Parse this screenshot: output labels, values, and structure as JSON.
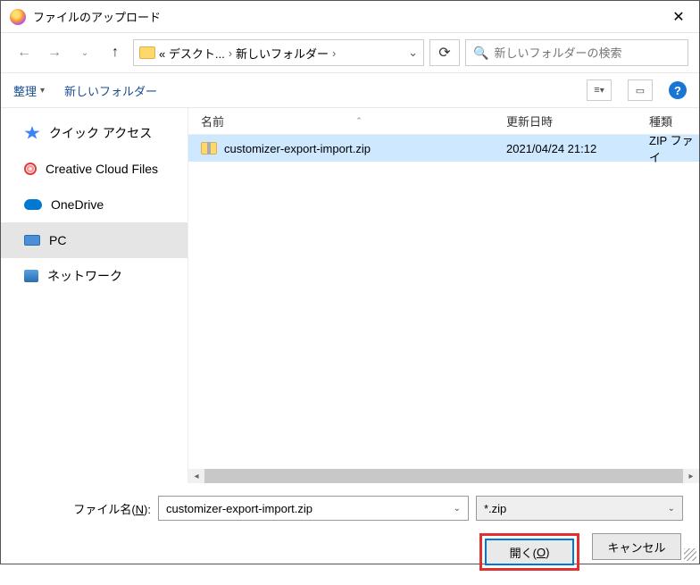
{
  "window": {
    "title": "ファイルのアップロード"
  },
  "breadcrumb": {
    "seg1": "« デスクト...",
    "seg2": "新しいフォルダー"
  },
  "search": {
    "placeholder": "新しいフォルダーの検索"
  },
  "toolbar": {
    "organize": "整理",
    "newfolder": "新しいフォルダー"
  },
  "sidebar": {
    "items": [
      {
        "label": "クイック アクセス"
      },
      {
        "label": "Creative Cloud Files"
      },
      {
        "label": "OneDrive"
      },
      {
        "label": "PC"
      },
      {
        "label": "ネットワーク"
      }
    ]
  },
  "columns": {
    "name": "名前",
    "date": "更新日時",
    "type": "種類"
  },
  "files": [
    {
      "name": "customizer-export-import.zip",
      "date": "2021/04/24 21:12",
      "type": "ZIP ファイ"
    }
  ],
  "filename": {
    "label_pre": "ファイル名(",
    "label_key": "N",
    "label_post": "):",
    "value": "customizer-export-import.zip"
  },
  "filter": {
    "value": "*.zip"
  },
  "buttons": {
    "open_pre": "開く(",
    "open_key": "O",
    "open_post": ")",
    "cancel": "キャンセル"
  }
}
